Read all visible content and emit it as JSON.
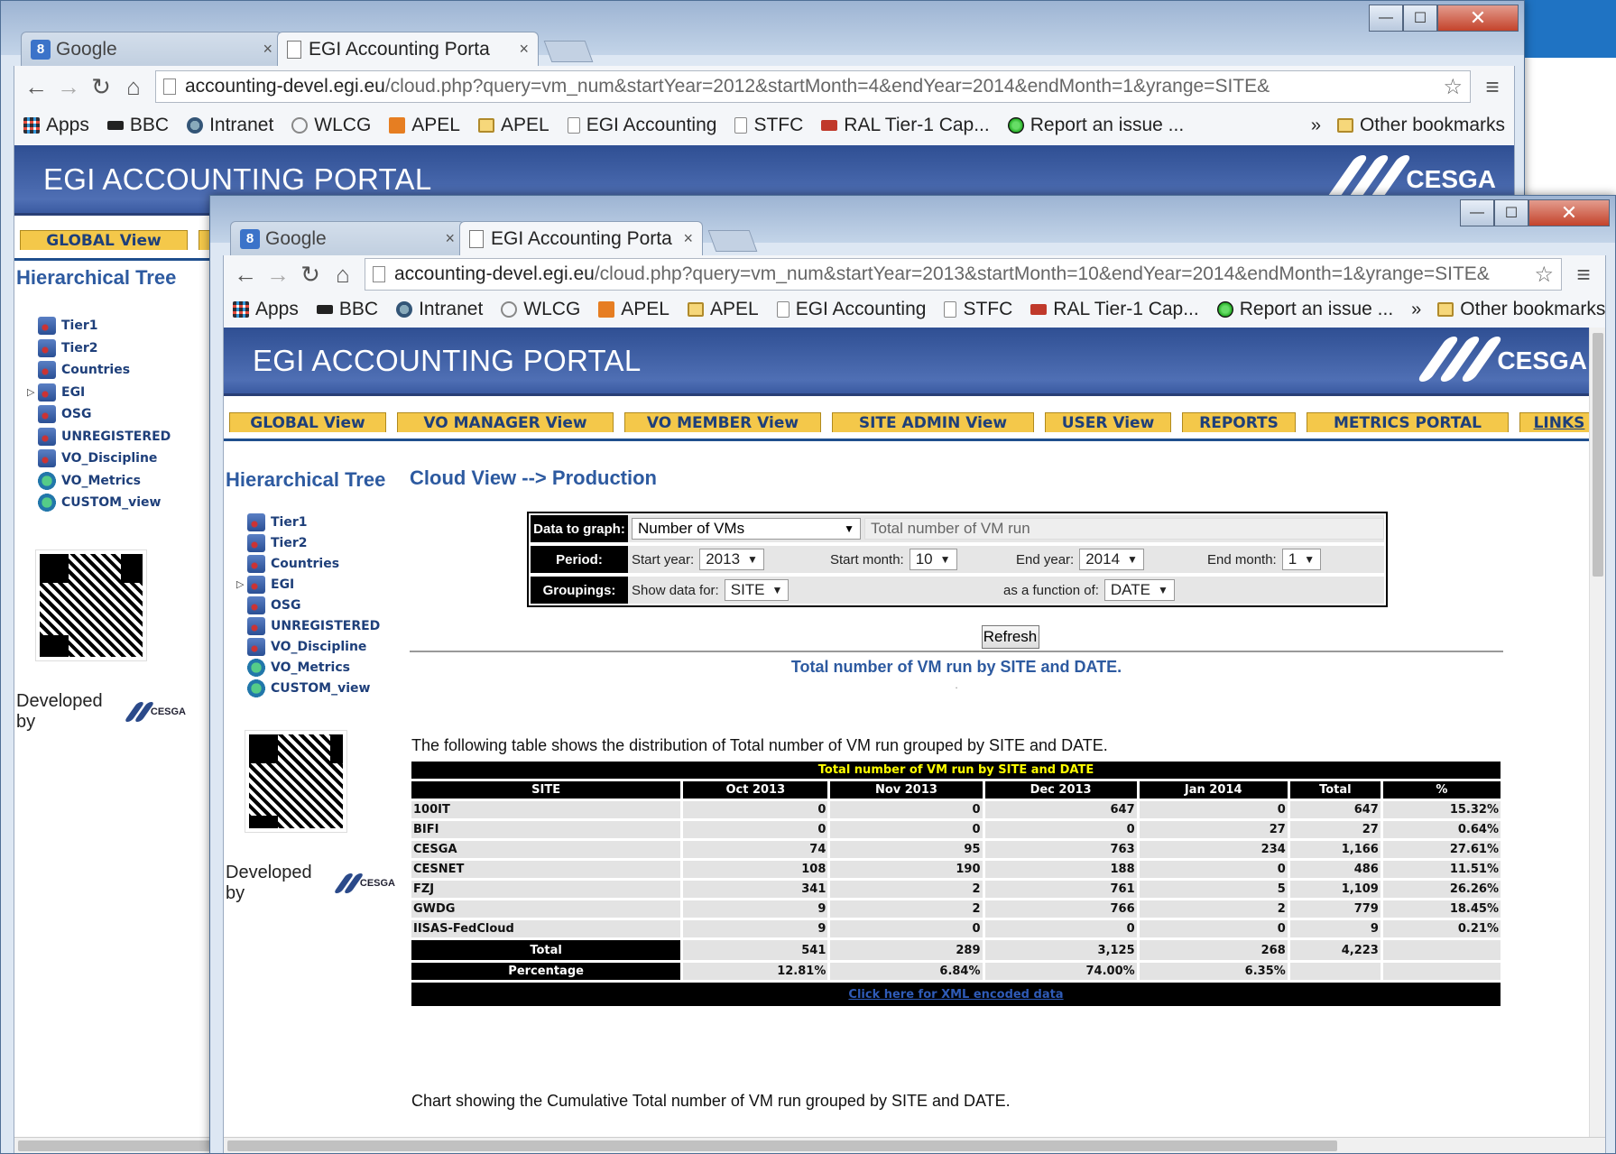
{
  "background": {
    "accent_strip_color": "#1f73c3"
  },
  "browser": {
    "tabs": [
      {
        "label": "Google",
        "icon": "google-icon",
        "close": "×"
      },
      {
        "label": "EGI Accounting Porta",
        "icon": "page-icon",
        "close": "×"
      }
    ],
    "bookmarks": [
      {
        "label": "Apps",
        "icon": "apps-icon"
      },
      {
        "label": "BBC",
        "icon": "bbc-icon"
      },
      {
        "label": "Intranet",
        "icon": "intranet-icon"
      },
      {
        "label": "WLCG",
        "icon": "wlcg-icon"
      },
      {
        "label": "APEL",
        "icon": "check-icon"
      },
      {
        "label": "APEL",
        "icon": "folder-icon"
      },
      {
        "label": "EGI Accounting",
        "icon": "page-icon"
      },
      {
        "label": "STFC",
        "icon": "page-icon"
      },
      {
        "label": "RAL Tier-1 Cap...",
        "icon": "ral-icon"
      },
      {
        "label": "Report an issue ...",
        "icon": "green-circle-icon"
      }
    ],
    "bookmarks_overflow": "»",
    "other_bookmarks": "Other bookmarks"
  },
  "window_back": {
    "url_host": "accounting-devel.egi.eu",
    "url_path": "/cloud.php?query=vm_num&startYear=2012&startMonth=4&endYear=2014&endMonth=1&yrange=SITE&"
  },
  "window_front": {
    "url_host": "accounting-devel.egi.eu",
    "url_path": "/cloud.php?query=vm_num&startYear=2013&startMonth=10&endYear=2014&endMonth=1&yrange=SITE&"
  },
  "portal": {
    "title": "EGI ACCOUNTING PORTAL",
    "logo_text": "CESGA",
    "nav": [
      "GLOBAL View",
      "VO MANAGER View",
      "VO MEMBER View",
      "SITE ADMIN View",
      "USER View",
      "REPORTS",
      "METRICS PORTAL",
      "LINKS"
    ],
    "tree_title": "Hierarchical Tree",
    "tree": [
      {
        "label": "Tier1",
        "icon": "tree-node-icon"
      },
      {
        "label": "Tier2",
        "icon": "tree-node-icon"
      },
      {
        "label": "Countries",
        "icon": "tree-node-icon"
      },
      {
        "label": "EGI",
        "icon": "tree-node-icon",
        "expand": "▷"
      },
      {
        "label": "OSG",
        "icon": "tree-node-icon"
      },
      {
        "label": "UNREGISTERED",
        "icon": "tree-node-icon"
      },
      {
        "label": "VO_Discipline",
        "icon": "tree-node-icon"
      },
      {
        "label": "VO_Metrics",
        "icon": "globe-icon"
      },
      {
        "label": "CUSTOM_view",
        "icon": "globe-icon"
      }
    ],
    "developed_by": "Developed by",
    "developed_logo": "CESGA",
    "page_title": "Cloud View --> Production",
    "controls": {
      "data_label": "Data to graph:",
      "data_value": "Number of VMs",
      "data_desc": "Total number of VM run",
      "period_label": "Period:",
      "start_year_label": "Start year:",
      "start_year": "2013",
      "start_month_label": "Start month:",
      "start_month": "10",
      "end_year_label": "End year:",
      "end_year": "2014",
      "end_month_label": "End month:",
      "end_month": "1",
      "groupings_label": "Groupings:",
      "show_label": "Show data for:",
      "show_value": "SITE",
      "func_label": "as a function of:",
      "func_value": "DATE"
    },
    "refresh": "Refresh",
    "chart_title": "Total number of VM run by SITE and DATE.",
    "chart_dot": ".",
    "table_desc": "The following table shows the distribution of Total number of VM run grouped by SITE and DATE.",
    "table": {
      "caption": "Total number of VM run by SITE and DATE",
      "headers": [
        "SITE",
        "Oct 2013",
        "Nov 2013",
        "Dec 2013",
        "Jan 2014",
        "Total",
        "%"
      ],
      "rows": [
        [
          "100IT",
          "0",
          "0",
          "647",
          "0",
          "647",
          "15.32%"
        ],
        [
          "BIFI",
          "0",
          "0",
          "0",
          "27",
          "27",
          "0.64%"
        ],
        [
          "CESGA",
          "74",
          "95",
          "763",
          "234",
          "1,166",
          "27.61%"
        ],
        [
          "CESNET",
          "108",
          "190",
          "188",
          "0",
          "486",
          "11.51%"
        ],
        [
          "FZJ",
          "341",
          "2",
          "761",
          "5",
          "1,109",
          "26.26%"
        ],
        [
          "GWDG",
          "9",
          "2",
          "766",
          "2",
          "779",
          "18.45%"
        ],
        [
          "IISAS-FedCloud",
          "9",
          "0",
          "0",
          "0",
          "9",
          "0.21%"
        ]
      ],
      "total_row": [
        "Total",
        "541",
        "289",
        "3,125",
        "268",
        "4,223"
      ],
      "pct_row": [
        "Percentage",
        "12.81%",
        "6.84%",
        "74.00%",
        "6.35%"
      ],
      "xml_link": "Click here for XML encoded data"
    },
    "chart_desc": "Chart showing the Cumulative Total number of VM run grouped by SITE and DATE."
  }
}
